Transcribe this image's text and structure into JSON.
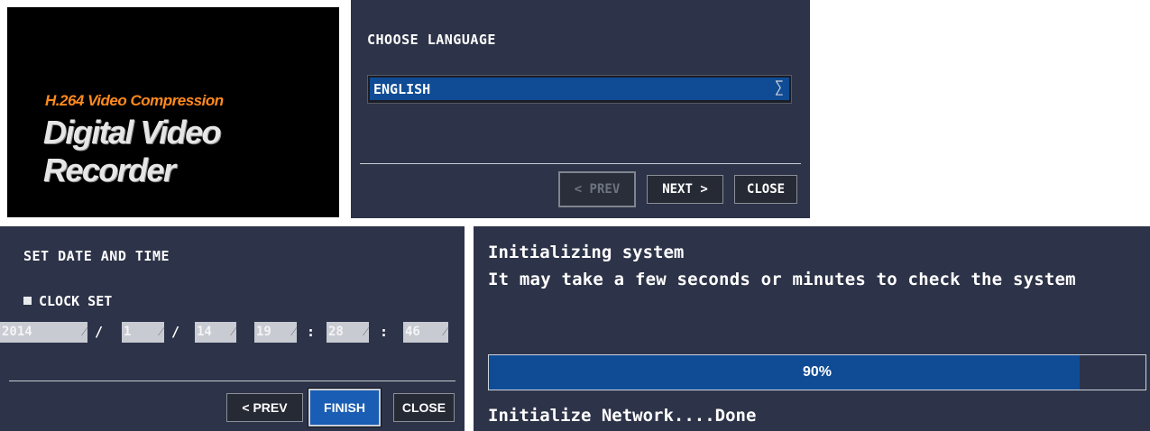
{
  "splash": {
    "subtitle": "H.264 Video Compression",
    "title": "Digital Video Recorder"
  },
  "language_panel": {
    "title": "CHOOSE LANGUAGE",
    "selected_language": "ENGLISH",
    "arrow_glyph": "∑",
    "buttons": {
      "prev": "< PREV",
      "next": "NEXT >",
      "close": "CLOSE"
    }
  },
  "datetime_panel": {
    "title": "SET DATE AND TIME",
    "clock_set_label": "CLOCK SET",
    "fields": {
      "year": "2014",
      "month": "1",
      "day": "14",
      "hour": "19",
      "minute": "28",
      "second": "46"
    },
    "caret": "⁄",
    "separators": {
      "date": "/",
      "time": ":"
    },
    "buttons": {
      "prev": "< PREV",
      "finish": "FINISH",
      "close": "CLOSE"
    }
  },
  "init_panel": {
    "line1": "Initializing system",
    "line2": "It may take a few seconds or minutes to check the system",
    "progress_percent": 90,
    "progress_label": "90%",
    "status": "Initialize Network....Done"
  },
  "colors": {
    "panel_bg": "#2d3348",
    "accent_blue": "#0f4c95",
    "splash_orange": "#ff8a1e"
  }
}
